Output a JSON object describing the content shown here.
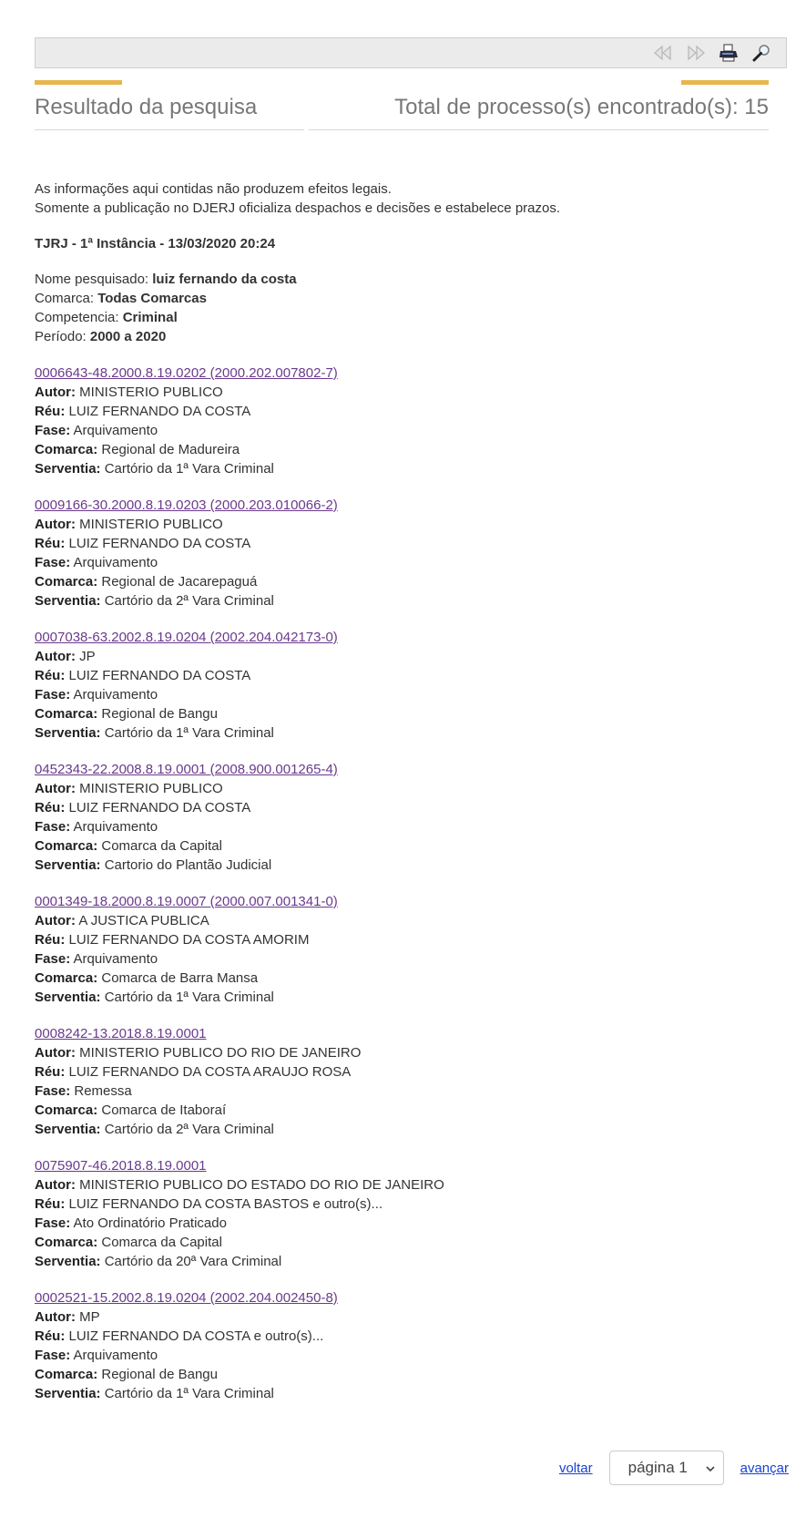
{
  "toolbar": {
    "icons": [
      "first-page-icon",
      "next-page-icon",
      "print-icon",
      "search-icon"
    ]
  },
  "header": {
    "left_title": "Resultado da pesquisa",
    "right_title": "Total de processo(s) encontrado(s): 15"
  },
  "notice": {
    "line1": "As informações aqui contidas não produzem efeitos legais.",
    "line2": "Somente a publicação no DJERJ oficializa despachos e decisões e estabelece prazos."
  },
  "court_line": "TJRJ - 1ª Instância - 13/03/2020 20:24",
  "query": {
    "nome_label": "Nome pesquisado: ",
    "nome_value": "luiz fernando da costa",
    "comarca_label": "Comarca: ",
    "comarca_value": "Todas Comarcas",
    "competencia_label": "Competencia: ",
    "competencia_value": "Criminal",
    "periodo_label": "Período: ",
    "periodo_value": "2000 a 2020"
  },
  "labels": {
    "autor": "Autor:",
    "reu": "Réu:",
    "fase": "Fase:",
    "comarca": "Comarca:",
    "serventia": "Serventia:"
  },
  "processes": [
    {
      "number": "0006643-48.2000.8.19.0202 (2000.202.007802-7)",
      "autor": "MINISTERIO PUBLICO",
      "reu": "LUIZ FERNANDO DA COSTA",
      "fase": "Arquivamento",
      "comarca": "Regional de Madureira",
      "serventia": "Cartório da 1ª Vara Criminal"
    },
    {
      "number": "0009166-30.2000.8.19.0203 (2000.203.010066-2)",
      "autor": "MINISTERIO PUBLICO",
      "reu": "LUIZ FERNANDO DA COSTA",
      "fase": "Arquivamento",
      "comarca": "Regional de Jacarepaguá",
      "serventia": "Cartório da 2ª Vara Criminal"
    },
    {
      "number": "0007038-63.2002.8.19.0204 (2002.204.042173-0)",
      "autor": "JP",
      "reu": "LUIZ FERNANDO DA COSTA",
      "fase": "Arquivamento",
      "comarca": "Regional de Bangu",
      "serventia": "Cartório da 1ª Vara Criminal"
    },
    {
      "number": "0452343-22.2008.8.19.0001 (2008.900.001265-4)",
      "autor": "MINISTERIO PUBLICO",
      "reu": "LUIZ FERNANDO DA COSTA",
      "fase": "Arquivamento",
      "comarca": "Comarca da Capital",
      "serventia": "Cartorio do Plantão Judicial"
    },
    {
      "number": "0001349-18.2000.8.19.0007 (2000.007.001341-0)",
      "autor": "A JUSTICA PUBLICA",
      "reu": "LUIZ FERNANDO DA COSTA AMORIM",
      "fase": "Arquivamento",
      "comarca": "Comarca de Barra Mansa",
      "serventia": "Cartório da 1ª Vara Criminal"
    },
    {
      "number": "0008242-13.2018.8.19.0001",
      "autor": "MINISTERIO PUBLICO DO RIO DE JANEIRO",
      "reu": "LUIZ FERNANDO DA COSTA ARAUJO ROSA",
      "fase": "Remessa",
      "comarca": "Comarca de Itaboraí",
      "serventia": "Cartório da 2ª Vara Criminal"
    },
    {
      "number": "0075907-46.2018.8.19.0001",
      "autor": "MINISTERIO PUBLICO DO ESTADO DO RIO DE JANEIRO",
      "reu": "LUIZ FERNANDO DA COSTA BASTOS e outro(s)...",
      "fase": "Ato Ordinatório Praticado",
      "comarca": "Comarca da Capital",
      "serventia": "Cartório da 20ª Vara Criminal"
    },
    {
      "number": "0002521-15.2002.8.19.0204 (2002.204.002450-8)",
      "autor": "MP",
      "reu": "LUIZ FERNANDO DA COSTA e outro(s)...",
      "fase": "Arquivamento",
      "comarca": "Regional de Bangu",
      "serventia": "Cartório da 1ª Vara Criminal"
    }
  ],
  "pager": {
    "back_label": "voltar",
    "page_select_value": "página 1",
    "next_label": "avançar"
  }
}
